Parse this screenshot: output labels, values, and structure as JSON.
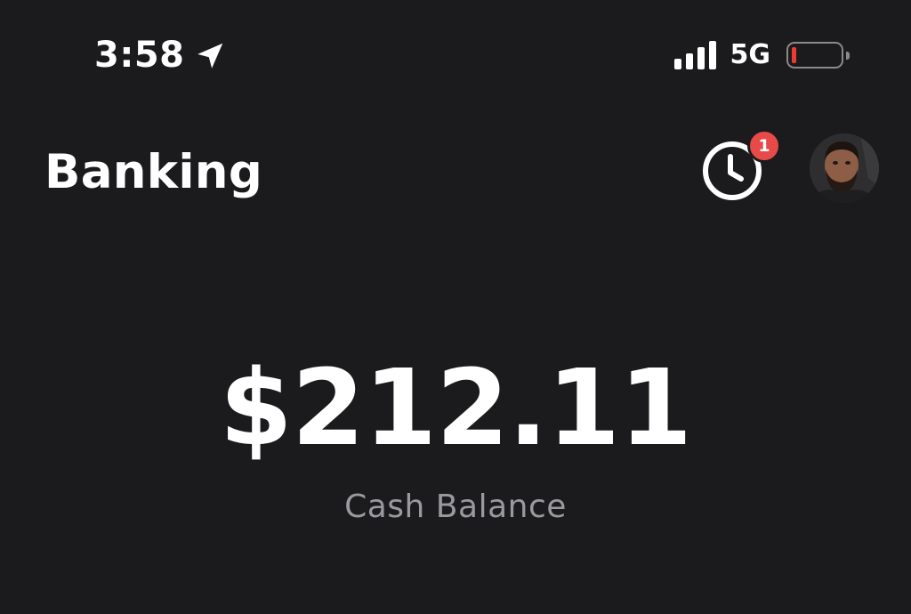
{
  "status_bar": {
    "time": "3:58",
    "network": "5G",
    "location_icon": "location-arrow-icon",
    "signal_icon": "cellular-signal-icon",
    "signal_bars": 4,
    "battery_icon": "battery-icon",
    "battery_level_fraction": 0.1,
    "battery_color": "#ec3b33"
  },
  "header": {
    "title": "Banking",
    "activity_icon": "clock-icon",
    "activity_badge_count": "1",
    "badge_color": "#e84a4a",
    "avatar_icon": "profile-avatar"
  },
  "balance": {
    "amount": "$212.11",
    "label": "Cash Balance"
  },
  "colors": {
    "background": "#1b1b1d",
    "text_primary": "#ffffff",
    "text_secondary": "#9a9a9e"
  }
}
